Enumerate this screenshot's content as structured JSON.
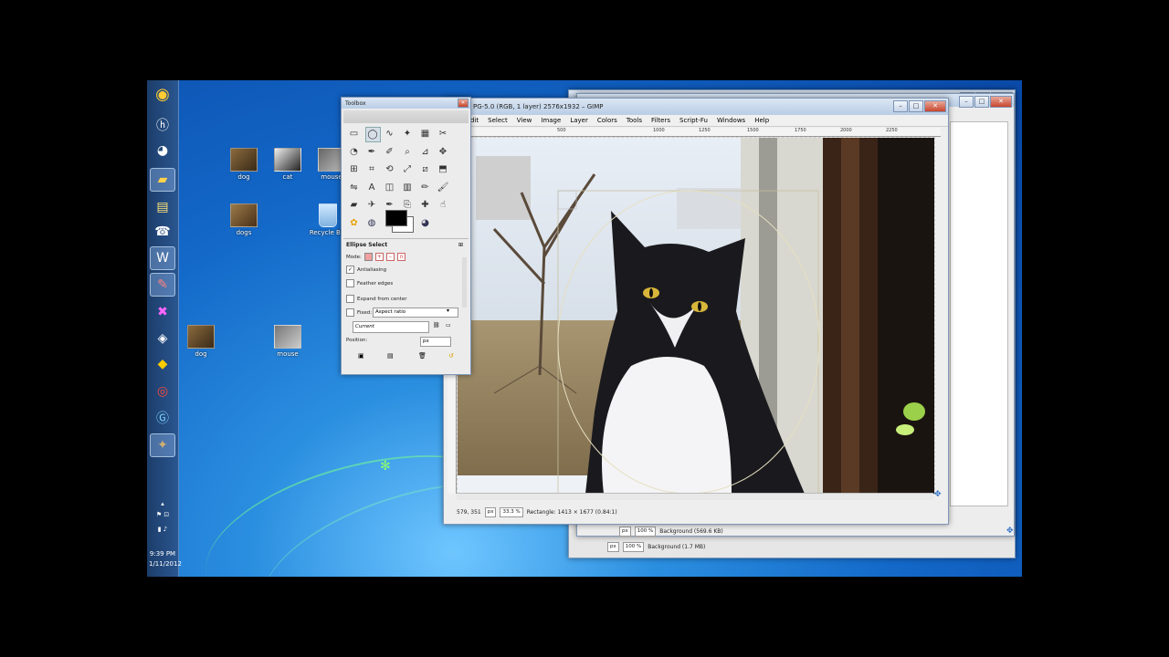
{
  "desktop": {
    "icons": [
      {
        "label": "dog"
      },
      {
        "label": "cat"
      },
      {
        "label": "mouse"
      },
      {
        "label": "dogs"
      },
      {
        "label": "Recycle Bin"
      },
      {
        "label": "dog"
      },
      {
        "label": "mouse"
      }
    ],
    "clock": {
      "time": "9:39 PM",
      "date": "1/11/2012"
    }
  },
  "toolbox": {
    "title": "Toolbox",
    "tool_options_title": "Ellipse Select",
    "mode_label": "Mode:",
    "antialiasing_label": "Antialiasing",
    "antialiasing_checked": true,
    "feather_label": "Feather edges",
    "expand_label": "Expand from center",
    "fixed_label": "Fixed:",
    "fixed_value": "Aspect ratio",
    "current_value": "Current",
    "position_label": "Position:",
    "position_unit": "px"
  },
  "image_window": {
    "title": "PG-5.0 (RGB, 1 layer) 2576x1932 – GIMP",
    "menus": [
      "dit",
      "Select",
      "View",
      "Image",
      "Layer",
      "Colors",
      "Tools",
      "Filters",
      "Script-Fu",
      "Windows",
      "Help"
    ],
    "ruler_ticks": [
      "500",
      "1000",
      "1250",
      "1500",
      "1750",
      "2000",
      "2250"
    ],
    "status_coords": "579, 351",
    "status_unit": "px",
    "status_zoom": "33.3 %",
    "status_text": "Rectangle: 1413 × 1677  (0.84:1)"
  },
  "back_window_1": {
    "unit": "px",
    "zoom": "100 %",
    "layer_text": "Background (569.6 KB)"
  },
  "back_window_2": {
    "unit": "px",
    "zoom": "100 %",
    "layer_text": "Background (1.7 MB)"
  },
  "colors": {
    "desktop_blue": "#1368c8",
    "gimp_panel": "#eeeeee",
    "title_blue": "#b9cde5"
  }
}
